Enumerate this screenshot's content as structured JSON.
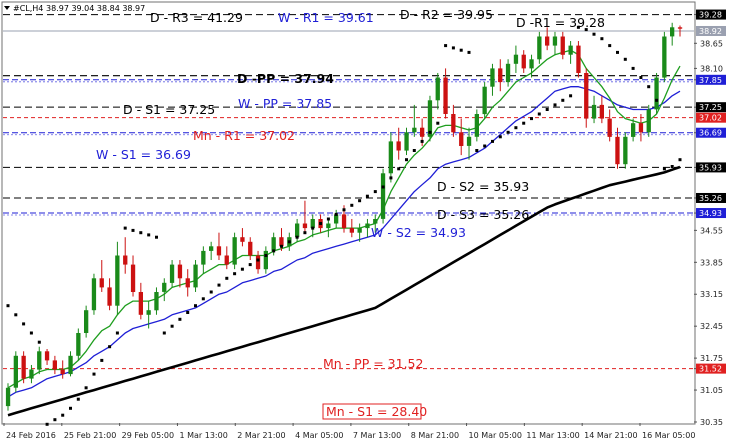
{
  "header": {
    "symbol": "#CL,H4",
    "ohlc": "38.97 39.04 38.84 38.97"
  },
  "colors": {
    "background": "#ffffff",
    "bull_candle": "#1a8a1a",
    "bear_candle": "#cc1111",
    "fast_ma": "#1e9e1e",
    "mid_ma": "#1f1fd6",
    "slow_ma": "#000000",
    "psar": "#000000",
    "daily_level": "#000000",
    "weekly_level": "#1f1fd6",
    "monthly_level": "#e02020",
    "price_line": "#9aa0b0"
  },
  "chart_data": {
    "type": "candlestick",
    "symbol": "#CL",
    "timeframe": "H4",
    "ylim": [
      30.35,
      39.38
    ],
    "y_ticks": [
      "39.28",
      "38.65",
      "38.10",
      "37.85",
      "37.25",
      "36.69",
      "35.93",
      "35.26",
      "34.93",
      "34.55",
      "33.85",
      "33.15",
      "32.45",
      "31.75",
      "31.52",
      "31.05",
      "30.35"
    ],
    "x_labels": [
      "24 Feb 2016",
      "25 Feb 21:00",
      "29 Feb 05:00",
      "1 Mar 13:00",
      "2 Mar 21:00",
      "4 Mar 05:00",
      "7 Mar 13:00",
      "8 Mar 21:00",
      "10 Mar 05:00",
      "11 Mar 13:00",
      "14 Mar 21:00",
      "16 Mar 05:00"
    ],
    "last_price": 38.92,
    "levels": [
      {
        "label": "D - R3 = 41.29",
        "value": 41.29,
        "group": "daily",
        "line": false
      },
      {
        "label": "W - R1 = 39.61",
        "value": 39.61,
        "group": "weekly",
        "line": false
      },
      {
        "label": "D - R2 = 39.95",
        "value": 39.95,
        "group": "daily",
        "line": false
      },
      {
        "label": "D -R1 = 39.28",
        "value": 39.28,
        "group": "daily",
        "line": true
      },
      {
        "label": "D -PP = 37.94",
        "value": 37.94,
        "group": "daily",
        "line": true,
        "bold": true
      },
      {
        "label": "W - PP = 37.85",
        "value": 37.85,
        "group": "weekly",
        "line": true
      },
      {
        "label": "D - S1 = 37.25",
        "value": 37.25,
        "group": "daily",
        "line": true
      },
      {
        "label": "Mn - R1 = 37.02",
        "value": 37.02,
        "group": "monthly",
        "line": true
      },
      {
        "label": "W - S1 = 36.69",
        "value": 36.69,
        "group": "weekly",
        "line": true
      },
      {
        "label": "D - S2 = 35.93",
        "value": 35.93,
        "group": "daily",
        "line": true
      },
      {
        "label": "D - S3 = 35.26",
        "value": 35.26,
        "group": "daily",
        "line": true
      },
      {
        "label": "W - S2 = 34.93",
        "value": 34.93,
        "group": "weekly",
        "line": true
      },
      {
        "label": "Mn - PP = 31.52",
        "value": 31.52,
        "group": "monthly",
        "line": true
      },
      {
        "label": "Mn - S1 = 28.40",
        "value": 28.4,
        "group": "monthly",
        "line": false,
        "boxed": true
      }
    ],
    "axis_tags": [
      {
        "value": 39.28,
        "text": "39.28",
        "group": "daily"
      },
      {
        "value": 38.92,
        "text": "38.92",
        "group": "price"
      },
      {
        "value": 37.85,
        "text": "37.85",
        "group": "weekly"
      },
      {
        "value": 37.25,
        "text": "37.25",
        "group": "daily"
      },
      {
        "value": 37.02,
        "text": "37.02",
        "group": "monthly"
      },
      {
        "value": 36.69,
        "text": "36.69",
        "group": "weekly"
      },
      {
        "value": 35.93,
        "text": "35.93",
        "group": "daily"
      },
      {
        "value": 35.26,
        "text": "35.26",
        "group": "daily"
      },
      {
        "value": 34.93,
        "text": "34.93",
        "group": "weekly"
      },
      {
        "value": 31.52,
        "text": "31.52",
        "group": "monthly"
      }
    ],
    "candles": [
      [
        30.7,
        31.2,
        30.6,
        31.1
      ],
      [
        31.1,
        31.9,
        31.0,
        31.8
      ],
      [
        31.8,
        31.9,
        31.2,
        31.3
      ],
      [
        31.3,
        31.6,
        31.2,
        31.5
      ],
      [
        31.5,
        32.0,
        31.4,
        31.9
      ],
      [
        31.9,
        31.95,
        31.6,
        31.7
      ],
      [
        31.7,
        31.8,
        31.4,
        31.5
      ],
      [
        31.5,
        31.7,
        31.3,
        31.4
      ],
      [
        31.4,
        31.9,
        31.35,
        31.8
      ],
      [
        31.8,
        32.4,
        31.7,
        32.3
      ],
      [
        32.3,
        32.9,
        32.2,
        32.8
      ],
      [
        32.8,
        33.6,
        32.7,
        33.5
      ],
      [
        33.5,
        33.9,
        33.2,
        33.3
      ],
      [
        33.3,
        33.5,
        32.8,
        32.9
      ],
      [
        32.9,
        34.3,
        32.7,
        34.0
      ],
      [
        34.0,
        34.4,
        33.6,
        33.8
      ],
      [
        33.8,
        34.0,
        33.1,
        33.2
      ],
      [
        33.2,
        33.4,
        32.6,
        32.7
      ],
      [
        32.7,
        33.0,
        32.4,
        32.8
      ],
      [
        32.8,
        33.3,
        32.7,
        33.2
      ],
      [
        33.2,
        33.5,
        33.0,
        33.4
      ],
      [
        33.4,
        33.9,
        33.3,
        33.8
      ],
      [
        33.8,
        33.9,
        33.3,
        33.5
      ],
      [
        33.5,
        33.7,
        33.1,
        33.3
      ],
      [
        33.3,
        33.9,
        33.2,
        33.8
      ],
      [
        33.8,
        34.2,
        33.6,
        34.1
      ],
      [
        34.1,
        34.3,
        33.9,
        34.2
      ],
      [
        34.2,
        34.5,
        33.9,
        34.0
      ],
      [
        34.0,
        34.2,
        33.7,
        33.8
      ],
      [
        33.8,
        34.5,
        33.7,
        34.4
      ],
      [
        34.4,
        34.6,
        34.2,
        34.3
      ],
      [
        34.3,
        34.4,
        33.9,
        34.0
      ],
      [
        34.0,
        34.1,
        33.6,
        33.7
      ],
      [
        33.7,
        34.2,
        33.6,
        34.1
      ],
      [
        34.1,
        34.5,
        34.0,
        34.4
      ],
      [
        34.4,
        34.6,
        34.1,
        34.2
      ],
      [
        34.2,
        34.5,
        34.1,
        34.4
      ],
      [
        34.4,
        34.8,
        34.3,
        34.7
      ],
      [
        34.7,
        35.2,
        34.5,
        34.6
      ],
      [
        34.6,
        34.9,
        34.4,
        34.8
      ],
      [
        34.8,
        34.9,
        34.5,
        34.6
      ],
      [
        34.6,
        34.8,
        34.4,
        34.7
      ],
      [
        34.7,
        35.0,
        34.6,
        34.9
      ],
      [
        34.9,
        35.1,
        34.5,
        34.6
      ],
      [
        34.6,
        34.8,
        34.4,
        34.5
      ],
      [
        34.5,
        34.7,
        34.3,
        34.6
      ],
      [
        34.6,
        34.8,
        34.4,
        34.7
      ],
      [
        34.7,
        34.9,
        34.5,
        34.8
      ],
      [
        34.8,
        35.9,
        34.7,
        35.8
      ],
      [
        35.8,
        36.7,
        35.6,
        36.5
      ],
      [
        36.5,
        36.8,
        36.1,
        36.3
      ],
      [
        36.3,
        36.8,
        36.2,
        36.7
      ],
      [
        36.7,
        37.3,
        36.6,
        36.8
      ],
      [
        36.8,
        37.0,
        36.4,
        36.6
      ],
      [
        36.6,
        37.5,
        36.5,
        37.4
      ],
      [
        37.4,
        38.0,
        37.2,
        37.9
      ],
      [
        37.9,
        38.1,
        37.0,
        37.1
      ],
      [
        37.1,
        37.3,
        36.6,
        36.7
      ],
      [
        36.7,
        37.0,
        36.2,
        36.4
      ],
      [
        36.4,
        36.8,
        36.1,
        36.6
      ],
      [
        36.6,
        37.2,
        36.5,
        37.1
      ],
      [
        37.1,
        37.8,
        37.0,
        37.7
      ],
      [
        37.7,
        38.2,
        37.5,
        38.1
      ],
      [
        38.1,
        38.3,
        37.6,
        37.8
      ],
      [
        37.8,
        38.3,
        37.7,
        38.2
      ],
      [
        38.2,
        38.6,
        38.0,
        38.4
      ],
      [
        38.4,
        38.5,
        38.0,
        38.1
      ],
      [
        38.1,
        38.4,
        37.9,
        38.3
      ],
      [
        38.3,
        38.9,
        38.2,
        38.8
      ],
      [
        38.8,
        39.0,
        38.5,
        38.6
      ],
      [
        38.6,
        38.9,
        38.4,
        38.8
      ],
      [
        38.8,
        38.9,
        38.3,
        38.4
      ],
      [
        38.4,
        38.7,
        38.2,
        38.6
      ],
      [
        38.6,
        38.7,
        37.9,
        38.0
      ],
      [
        38.0,
        38.1,
        36.8,
        37.0
      ],
      [
        37.0,
        37.5,
        36.9,
        37.3
      ],
      [
        37.3,
        37.5,
        36.9,
        37.0
      ],
      [
        37.0,
        37.2,
        36.5,
        36.6
      ],
      [
        36.6,
        36.8,
        35.9,
        36.0
      ],
      [
        36.0,
        36.7,
        35.9,
        36.6
      ],
      [
        36.6,
        37.0,
        36.5,
        36.9
      ],
      [
        36.9,
        37.1,
        36.5,
        36.7
      ],
      [
        36.7,
        37.3,
        36.6,
        37.2
      ],
      [
        37.2,
        38.0,
        37.1,
        37.9
      ],
      [
        37.9,
        38.9,
        37.8,
        38.8
      ],
      [
        38.8,
        39.1,
        38.6,
        39.0
      ],
      [
        39.0,
        39.04,
        38.8,
        38.97
      ]
    ],
    "indicators": {
      "fast_ma": [
        31.1,
        31.2,
        31.3,
        31.35,
        31.45,
        31.5,
        31.5,
        31.5,
        31.55,
        31.7,
        31.9,
        32.15,
        32.35,
        32.45,
        32.7,
        32.9,
        33.0,
        33.0,
        33.0,
        33.05,
        33.15,
        33.3,
        33.35,
        33.4,
        33.45,
        33.6,
        33.7,
        33.8,
        33.8,
        33.9,
        34.0,
        34.0,
        34.0,
        34.0,
        34.1,
        34.15,
        34.2,
        34.3,
        34.35,
        34.45,
        34.5,
        34.55,
        34.6,
        34.6,
        34.6,
        34.6,
        34.65,
        34.7,
        35.0,
        35.4,
        35.7,
        36.0,
        36.2,
        36.35,
        36.55,
        36.8,
        36.85,
        36.85,
        36.8,
        36.75,
        36.8,
        37.0,
        37.25,
        37.4,
        37.6,
        37.8,
        37.9,
        38.0,
        38.15,
        38.3,
        38.4,
        38.45,
        38.5,
        38.4,
        38.1,
        37.9,
        37.7,
        37.45,
        37.15,
        37.0,
        36.95,
        36.9,
        36.95,
        37.1,
        37.45,
        37.85,
        38.15
      ],
      "mid_ma": [
        30.9,
        31.0,
        31.05,
        31.1,
        31.2,
        31.3,
        31.35,
        31.4,
        31.45,
        31.55,
        31.65,
        31.8,
        31.9,
        32.0,
        32.15,
        32.3,
        32.4,
        32.45,
        32.5,
        32.55,
        32.6,
        32.7,
        32.75,
        32.8,
        32.85,
        32.95,
        33.05,
        33.15,
        33.2,
        33.3,
        33.4,
        33.45,
        33.5,
        33.55,
        33.65,
        33.7,
        33.8,
        33.9,
        33.95,
        34.05,
        34.1,
        34.15,
        34.2,
        34.25,
        34.3,
        34.35,
        34.4,
        34.45,
        34.6,
        34.8,
        35.0,
        35.2,
        35.4,
        35.55,
        35.7,
        35.9,
        36.0,
        36.05,
        36.1,
        36.15,
        36.25,
        36.35,
        36.5,
        36.65,
        36.8,
        36.95,
        37.05,
        37.15,
        37.3,
        37.45,
        37.6,
        37.65,
        37.7,
        37.7,
        37.65,
        37.6,
        37.5,
        37.4,
        37.3,
        37.25,
        37.2,
        37.2,
        37.2,
        37.25,
        37.35,
        37.5,
        37.6
      ],
      "slow_ma": [
        30.5,
        30.55,
        30.6,
        30.65,
        30.7,
        30.75,
        30.8,
        30.85,
        30.9,
        30.95,
        31.0,
        31.05,
        31.1,
        31.15,
        31.2,
        31.25,
        31.3,
        31.35,
        31.4,
        31.45,
        31.5,
        31.55,
        31.6,
        31.65,
        31.7,
        31.75,
        31.8,
        31.85,
        31.9,
        31.95,
        32.0,
        32.05,
        32.1,
        32.15,
        32.2,
        32.25,
        32.3,
        32.35,
        32.4,
        32.45,
        32.5,
        32.55,
        32.6,
        32.65,
        32.7,
        32.75,
        32.8,
        32.85,
        32.95,
        33.05,
        33.15,
        33.25,
        33.35,
        33.45,
        33.55,
        33.65,
        33.75,
        33.85,
        33.95,
        34.05,
        34.15,
        34.25,
        34.35,
        34.45,
        34.55,
        34.65,
        34.75,
        34.85,
        34.95,
        35.05,
        35.12,
        35.18,
        35.24,
        35.3,
        35.36,
        35.42,
        35.48,
        35.54,
        35.58,
        35.62,
        35.66,
        35.7,
        35.74,
        35.78,
        35.82,
        35.88,
        35.94
      ],
      "psar": [
        32.9,
        32.7,
        32.5,
        32.3,
        32.1,
        30.3,
        30.4,
        30.5,
        30.65,
        30.85,
        31.1,
        31.4,
        31.7,
        32.0,
        32.3,
        34.6,
        34.55,
        34.5,
        34.45,
        34.4,
        32.3,
        32.45,
        32.6,
        32.75,
        32.9,
        33.05,
        33.2,
        33.35,
        33.5,
        33.6,
        33.7,
        33.8,
        33.9,
        34.0,
        34.1,
        34.2,
        34.3,
        34.4,
        34.5,
        34.6,
        34.7,
        34.8,
        34.9,
        35.0,
        35.1,
        35.2,
        35.3,
        35.4,
        35.5,
        35.7,
        35.9,
        36.1,
        36.3,
        36.5,
        36.7,
        36.9,
        38.6,
        38.55,
        38.5,
        38.45,
        36.3,
        36.4,
        36.5,
        36.6,
        36.7,
        36.8,
        36.9,
        37.0,
        37.1,
        37.2,
        37.3,
        37.4,
        37.5,
        39.0,
        38.95,
        38.85,
        38.75,
        38.6,
        38.45,
        38.3,
        38.1,
        37.9,
        37.7,
        37.4,
        35.9,
        35.95,
        36.1
      ]
    }
  }
}
